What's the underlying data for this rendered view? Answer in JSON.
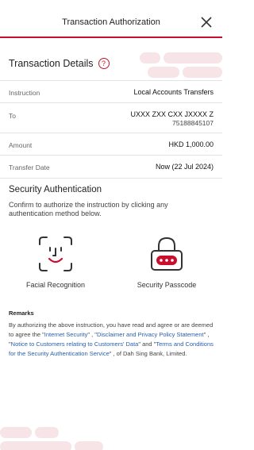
{
  "header": {
    "title": "Transaction Authorization"
  },
  "details": {
    "title": "Transaction Details",
    "help_symbol": "?",
    "rows": [
      {
        "label": "Instruction",
        "value": "Local Accounts Transfers",
        "sub": ""
      },
      {
        "label": "To",
        "value": "UXXX ZXX CXX JXXXX Z",
        "sub": "75188845107"
      },
      {
        "label": "Amount",
        "value": "HKD 1,000.00",
        "sub": ""
      },
      {
        "label": "Transfer Date",
        "value": "Now (22 Jul 2024)",
        "sub": ""
      }
    ]
  },
  "security": {
    "title": "Security Authentication",
    "description": "Confirm to authorize the instruction by clicking any authentication method below.",
    "methods": [
      {
        "label": "Facial Recognition",
        "icon": "face-scan-icon"
      },
      {
        "label": "Security Passcode",
        "icon": "padlock-passcode-icon"
      }
    ]
  },
  "remarks": {
    "title": "Remarks",
    "text_1": "By authorizing the above instruction, you have read and agree or are deemed to agree the \"",
    "link_1": "Internet Security",
    "text_2": "\" , \"",
    "link_2": "Disclaimer and Privacy Policy Statement",
    "text_3": "\" , \"",
    "link_3": "Notice to Customers relating to Customers' Data",
    "text_4": "\" and \"",
    "link_4": "Terms and Conditions for the Security Authentication Service",
    "text_5": "\" , of Dah Sing Bank, Limited."
  },
  "colors": {
    "accent": "#c8102e",
    "link": "#2a5fa8",
    "deco": "#f7e4e7"
  }
}
